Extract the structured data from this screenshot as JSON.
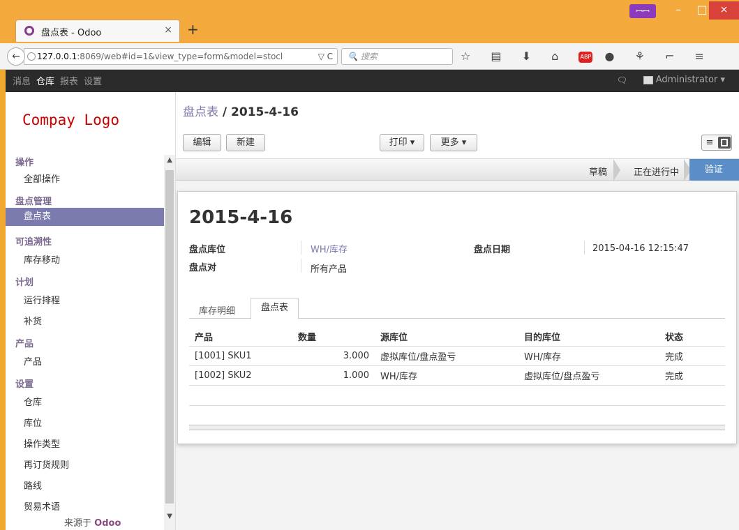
{
  "browser": {
    "tab_title": "盘点表 - Odoo",
    "tab_close": "×",
    "new_tab": "+",
    "url_prefix": "127.0.0.1",
    "url_rest": ":8069/web#id=1&view_type=form&model=stocl",
    "url_tail": "▽ C",
    "search_placeholder": "搜索",
    "mask_glyph": "ꟷꟷ",
    "win_min": "–",
    "win_max": "□",
    "win_close": "×",
    "toolbar_glyphs": "☆ ▤ ⬇ ⌂",
    "abp": "ABP",
    "toolbar_glyphs2": "● ⚘ ⌐ ≡"
  },
  "odoo_menu": {
    "items": [
      "消息",
      "仓库",
      "报表",
      "设置"
    ],
    "active": "仓库",
    "chat_icon": "🗨",
    "user": "Administrator ▾"
  },
  "sidebar": {
    "logo": "Compay Logo",
    "sections": [
      {
        "title": "操作",
        "items": [
          "全部操作"
        ]
      },
      {
        "title": "盘点管理",
        "items": [
          "盘点表"
        ]
      },
      {
        "title": "可追溯性",
        "items": [
          "库存移动"
        ]
      },
      {
        "title": "计划",
        "items": [
          "运行排程",
          "补货"
        ]
      },
      {
        "title": "产品",
        "items": [
          "产品"
        ]
      },
      {
        "title": "设置",
        "items": [
          "仓库",
          "库位",
          "操作类型",
          "再订货规则",
          "路线",
          "贸易术语"
        ]
      }
    ],
    "selected": "盘点表",
    "powered_prefix": "来源于",
    "powered_brand": "Odoo",
    "scroll_up": "▲",
    "scroll_down": "▼"
  },
  "header": {
    "breadcrumb_parent": "盘点表",
    "breadcrumb_sep": " / ",
    "breadcrumb_current": "2015-4-16",
    "btn_edit": "编辑",
    "btn_create": "新建",
    "btn_print": "打印 ▾",
    "btn_more": "更多 ▾",
    "list_icon": "≡"
  },
  "status": {
    "stages": [
      "草稿",
      "正在进行中",
      "验证"
    ],
    "current": "验证"
  },
  "record": {
    "title": "2015-4-16",
    "location_label": "盘点库位",
    "location_value": "WH/库存",
    "target_label": "盘点对",
    "target_value": "所有产品",
    "date_label": "盘点日期",
    "date_value": "2015-04-16 12:15:47"
  },
  "tabs": [
    "库存明细",
    "盘点表"
  ],
  "active_tab": "盘点表",
  "table": {
    "columns": [
      "产品",
      "数量",
      "源库位",
      "目的库位",
      "状态"
    ],
    "rows": [
      [
        "[1001] SKU1",
        "3.000",
        "虚拟库位/盘点盈亏",
        "WH/库存",
        "完成"
      ],
      [
        "[1002] SKU2",
        "1.000",
        "WH/库存",
        "虚拟库位/盘点盈亏",
        "完成"
      ]
    ]
  },
  "colors": {
    "accent": "#7c7bad",
    "status_current": "#5b8ec6",
    "window": "#f3a93b"
  }
}
